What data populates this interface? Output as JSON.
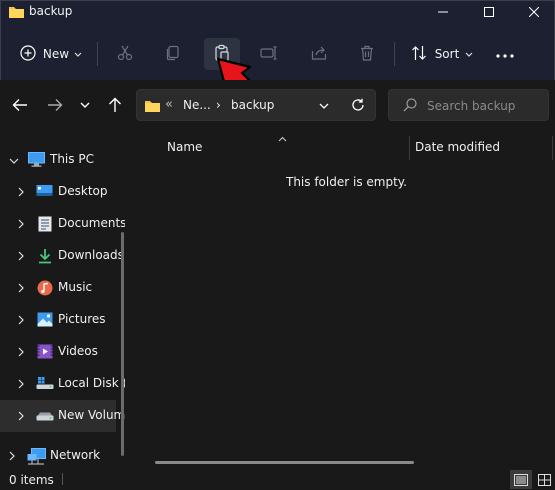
{
  "window": {
    "title": "backup"
  },
  "toolbar": {
    "new_label": "New",
    "sort_label": "Sort",
    "icons": [
      "new-icon",
      "cut-icon",
      "copy-icon",
      "paste-icon",
      "rename-icon",
      "share-icon",
      "delete-icon",
      "sort-icon",
      "more-icon"
    ]
  },
  "address": {
    "overflow": "«",
    "segments": [
      "Ne...",
      "backup"
    ],
    "separator": "›"
  },
  "search": {
    "placeholder": "Search backup"
  },
  "sidebar": {
    "items": [
      {
        "label": "This PC",
        "icon": "this-pc-icon",
        "expanded": true
      },
      {
        "label": "Desktop",
        "icon": "desktop-icon"
      },
      {
        "label": "Documents",
        "icon": "documents-icon"
      },
      {
        "label": "Downloads",
        "icon": "downloads-icon"
      },
      {
        "label": "Music",
        "icon": "music-icon"
      },
      {
        "label": "Pictures",
        "icon": "pictures-icon"
      },
      {
        "label": "Videos",
        "icon": "videos-icon"
      },
      {
        "label": "Local Disk (",
        "icon": "local-disk-icon"
      },
      {
        "label": "New Volum",
        "icon": "drive-icon",
        "selected": true
      },
      {
        "label": "Network",
        "icon": "network-icon"
      }
    ]
  },
  "content": {
    "columns": [
      "Name",
      "Date modified"
    ],
    "empty_message": "This folder is empty."
  },
  "status": {
    "item_count": "0 items"
  },
  "colors": {
    "window_bg": "#191919",
    "toolbar_bg": "#1c2030",
    "folder_yellow": "#f4c542",
    "annotation_red": "#e8141b",
    "accent_blue": "#3d9bf0"
  }
}
